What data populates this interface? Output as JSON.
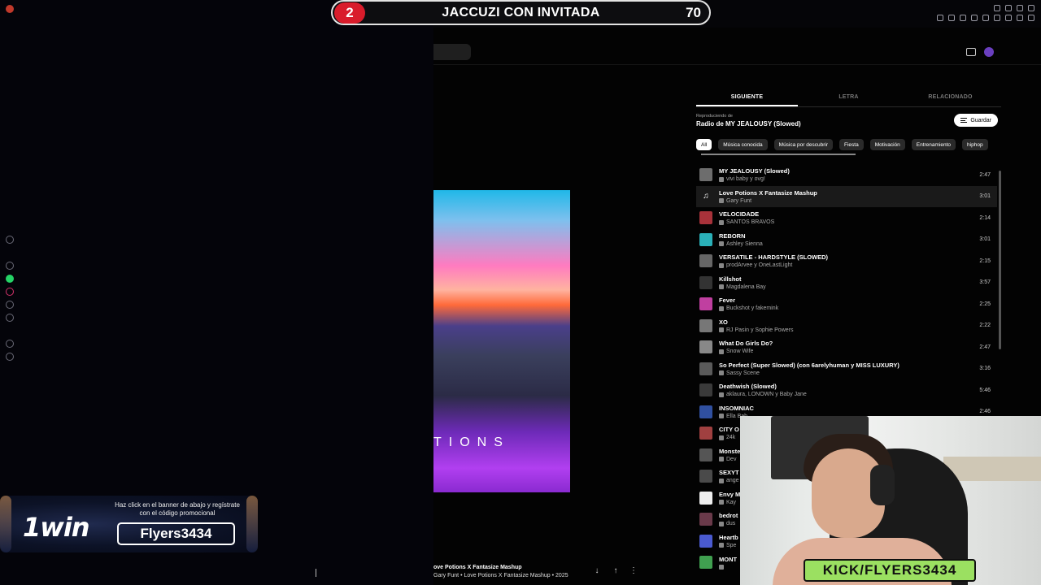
{
  "overlay": {
    "count": "2",
    "title": "JACCUZI CON INVITADA",
    "score": "70"
  },
  "tabs": [
    {
      "label": "SIGUIENTE",
      "active": true
    },
    {
      "label": "LETRA",
      "active": false
    },
    {
      "label": "RELACIONADO",
      "active": false
    }
  ],
  "queue": {
    "source_label": "Reproduciendo de",
    "source_title": "Radio de MY JEALOUSY (Slowed)",
    "save_label": "Guardar",
    "chips": [
      "All",
      "Música conocida",
      "Música por descubrir",
      "Fiesta",
      "Motivación",
      "Entrenamiento",
      "hiphop"
    ],
    "tracks": [
      {
        "title": "MY JEALOUSY (Slowed)",
        "artist": "vivi baby y ovg!",
        "duration": "2:47",
        "thumb": "#6d6d6d"
      },
      {
        "title": "Love Potions X Fantasize Mashup",
        "artist": "Gary Funt",
        "duration": "3:01",
        "thumb": "#7a3fbf",
        "playing": true
      },
      {
        "title": "VELOCIDADE",
        "artist": "SANTOS BRAVOS",
        "duration": "2:14",
        "thumb": "#a8323a"
      },
      {
        "title": "REBORN",
        "artist": "Ashley Sienna",
        "duration": "3:01",
        "thumb": "#2ab0b8"
      },
      {
        "title": "VERSATILE - HARDSTYLE (SLOWED)",
        "artist": "prodArvee y OneLastLight",
        "duration": "2:15",
        "thumb": "#666666"
      },
      {
        "title": "Killshot",
        "artist": "Magdalena Bay",
        "duration": "3:57",
        "thumb": "#333333"
      },
      {
        "title": "Fever",
        "artist": "Buckshot y fakemink",
        "duration": "2:25",
        "thumb": "#c03fa0"
      },
      {
        "title": "XO",
        "artist": "RJ Pasin y Sophie Powers",
        "duration": "2:22",
        "thumb": "#777777"
      },
      {
        "title": "What Do Girls Do?",
        "artist": "Snow Wife",
        "duration": "2:47",
        "thumb": "#888888"
      },
      {
        "title": "So Perfect (Super Slowed) (con 6arelyhuman y MISS LUXURY)",
        "artist": "Sassy Scene",
        "duration": "3:16",
        "thumb": "#5a5a5a"
      },
      {
        "title": "Deathwish (Slowed)",
        "artist": "aklaura, LONOWN y Baby Jane",
        "duration": "5:46",
        "thumb": "#3a3a3a"
      },
      {
        "title": "INSOMNIAC",
        "artist": "Ella Bah",
        "duration": "2:46",
        "thumb": "#3050a0"
      },
      {
        "title": "CITY O",
        "artist": "24k",
        "duration": "",
        "thumb": "#a04040"
      },
      {
        "title": "Monste",
        "artist": "Dev",
        "duration": "",
        "thumb": "#555555"
      },
      {
        "title": "SEXYT",
        "artist": "ange",
        "duration": "",
        "thumb": "#4a4a4a"
      },
      {
        "title": "Envy M",
        "artist": "Kay",
        "duration": "",
        "thumb": "#eeeeee"
      },
      {
        "title": "bedrot",
        "artist": "dus",
        "duration": "",
        "thumb": "#6a3a4a"
      },
      {
        "title": "Heartb",
        "artist": "Spe",
        "duration": "",
        "thumb": "#4a5ad0"
      },
      {
        "title": "MONT",
        "artist": "",
        "duration": "",
        "thumb": "#40a050"
      }
    ]
  },
  "album": {
    "text": "TIONS"
  },
  "player": {
    "title": "ove Potions X Fantasize Mashup",
    "subtitle": "Gary Funt • Love Potions X Fantasize Mashup • 2025"
  },
  "ad": {
    "logo": "1win",
    "text": "Haz click en el banner de abajo  y regístrate con el código promocional",
    "code": "Flyers3434"
  },
  "webcam": {
    "label": "KICK/FLYERS3434"
  },
  "colors": {
    "accent_red": "#d91c2b",
    "kick_green": "#9be061",
    "background": "#030303"
  }
}
